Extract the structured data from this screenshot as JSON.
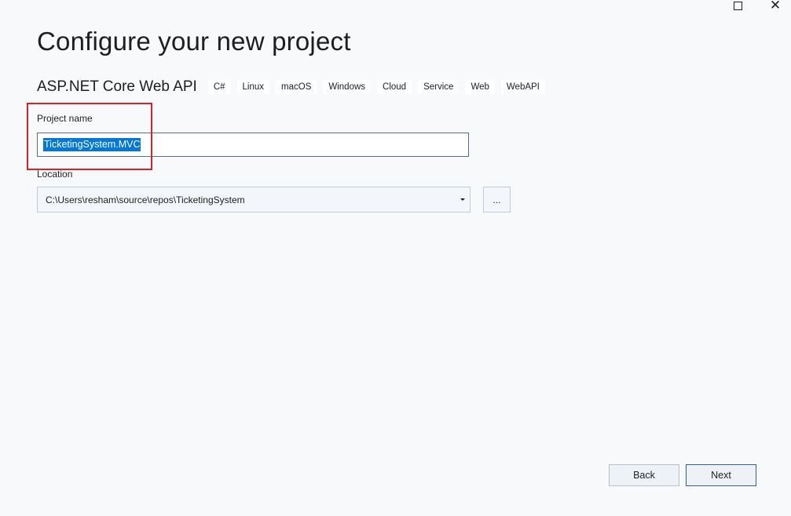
{
  "window": {
    "maximize_icon": "maximize-icon",
    "close_glyph": "✕"
  },
  "page": {
    "title": "Configure your new project"
  },
  "template": {
    "name": "ASP.NET Core Web API",
    "tags": [
      "C#",
      "Linux",
      "macOS",
      "Windows",
      "Cloud",
      "Service",
      "Web",
      "WebAPI"
    ]
  },
  "form": {
    "project_name_label": "Project name",
    "project_name_value": "TicketingSystem.MVC",
    "location_label": "Location",
    "location_value": "C:\\Users\\resham\\source\\repos\\TicketingSystem",
    "browse_label": "..."
  },
  "footer": {
    "back_label": "Back",
    "next_label": "Next"
  },
  "colors": {
    "background": "#f8f9fb",
    "selection": "#0078d7",
    "highlight_border": "#d6232a",
    "next_border": "#2e5f9e"
  }
}
